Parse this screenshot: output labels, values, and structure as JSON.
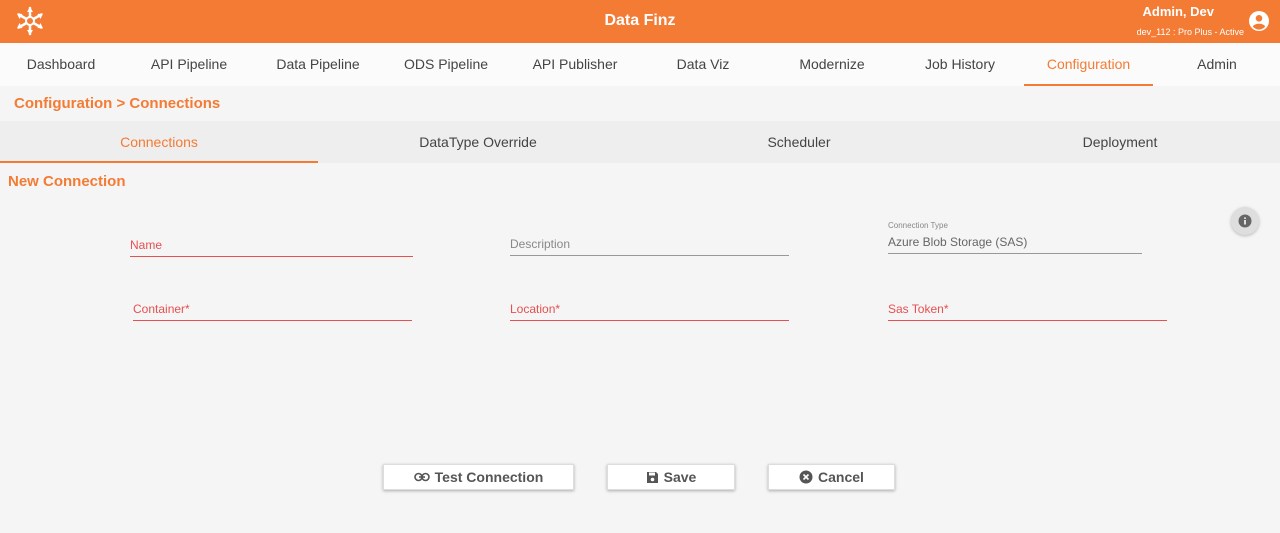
{
  "header": {
    "app_title": "Data Finz",
    "user_name": "Admin, Dev",
    "user_subtitle": "dev_112 : Pro Plus - Active",
    "brand_color": "#f47b34"
  },
  "nav": {
    "items": [
      {
        "label": "Dashboard"
      },
      {
        "label": "API Pipeline"
      },
      {
        "label": "Data Pipeline"
      },
      {
        "label": "ODS Pipeline"
      },
      {
        "label": "API Publisher"
      },
      {
        "label": "Data Viz"
      },
      {
        "label": "Modernize"
      },
      {
        "label": "Job History"
      },
      {
        "label": "Configuration"
      },
      {
        "label": "Admin"
      }
    ],
    "active": "Configuration"
  },
  "breadcrumb": "Configuration > Connections",
  "subtabs": {
    "items": [
      {
        "label": "Connections"
      },
      {
        "label": "DataType Override"
      },
      {
        "label": "Scheduler"
      },
      {
        "label": "Deployment"
      }
    ],
    "active": "Connections"
  },
  "form": {
    "title": "New Connection",
    "name_placeholder": "Name",
    "description_placeholder": "Description",
    "connection_type_label": "Connection Type",
    "connection_type_value": "Azure Blob Storage (SAS)",
    "container_placeholder": "Container*",
    "location_placeholder": "Location*",
    "sas_token_placeholder": "Sas Token*"
  },
  "actions": {
    "test_label": "Test Connection",
    "save_label": "Save",
    "cancel_label": "Cancel"
  },
  "icons": {
    "logo": "snowflake-logo-icon",
    "avatar": "account-circle-icon",
    "info": "info-icon",
    "test": "link-icon",
    "save": "floppy-disk-icon",
    "cancel": "close-circle-icon"
  }
}
